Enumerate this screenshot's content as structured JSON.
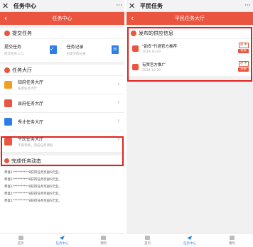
{
  "left": {
    "window_title": "任务中心",
    "more": "···",
    "close": "✕",
    "back": "‹",
    "nav_title": "任务中心",
    "submit_section": {
      "title": "提交任务",
      "cards": [
        {
          "title": "提交任务",
          "sub": "提交任务入口"
        },
        {
          "title": "任务记录",
          "sub": "已提交的记录"
        }
      ]
    },
    "hall_section": {
      "title": "任务大厅",
      "rows": [
        {
          "title": "知府任务大厅",
          "sub": "知府任务大厅",
          "icon_color": "#f0a020"
        },
        {
          "title": "县府任务大厅",
          "sub": "",
          "icon_color": "#e9553f"
        },
        {
          "title": "秀才任务大厅",
          "sub": "",
          "icon_color": "#2f7ee8"
        },
        {
          "title": "平民任务大厅",
          "sub": "不限等级，完成任务领取",
          "icon_color": "#e9553f"
        }
      ]
    },
    "done_section": {
      "title": "完成任务动态",
      "lines": [
        "恭喜1**********8获得任务奖励6元宝。",
        "恭喜1**********8获得任务奖励6元宝。",
        "恭喜1**********8获得任务奖励6元宝。",
        "恭喜1**********8获得任务奖励6元宝。",
        "恭喜1**********8获得任务奖励6元宝。"
      ]
    },
    "tabs": [
      {
        "label": "首页"
      },
      {
        "label": "任务中心"
      },
      {
        "label": "我的"
      }
    ]
  },
  "right": {
    "window_title": "平民任务",
    "more": "···",
    "close": "✕",
    "back": "‹",
    "nav_title": "平民任务大厅",
    "supply_section": {
      "title": "发布的供应信息",
      "items": [
        {
          "title": "\"韵安\"竹酒官方推荐",
          "date": "2019-10-29",
          "tag": "进 ",
          "tag_green": "中",
          "button": "领取"
        },
        {
          "title": "有赞官方推广",
          "date": "2019-10-29",
          "tag": "进 ",
          "tag_green": "中",
          "button": "领取"
        }
      ]
    },
    "tabs": [
      {
        "label": "首页"
      },
      {
        "label": "任务中心"
      },
      {
        "label": "我的"
      }
    ]
  },
  "colors": {
    "accent": "#e9553f",
    "highlight": "#e2211c",
    "blue": "#2f7ee8"
  }
}
